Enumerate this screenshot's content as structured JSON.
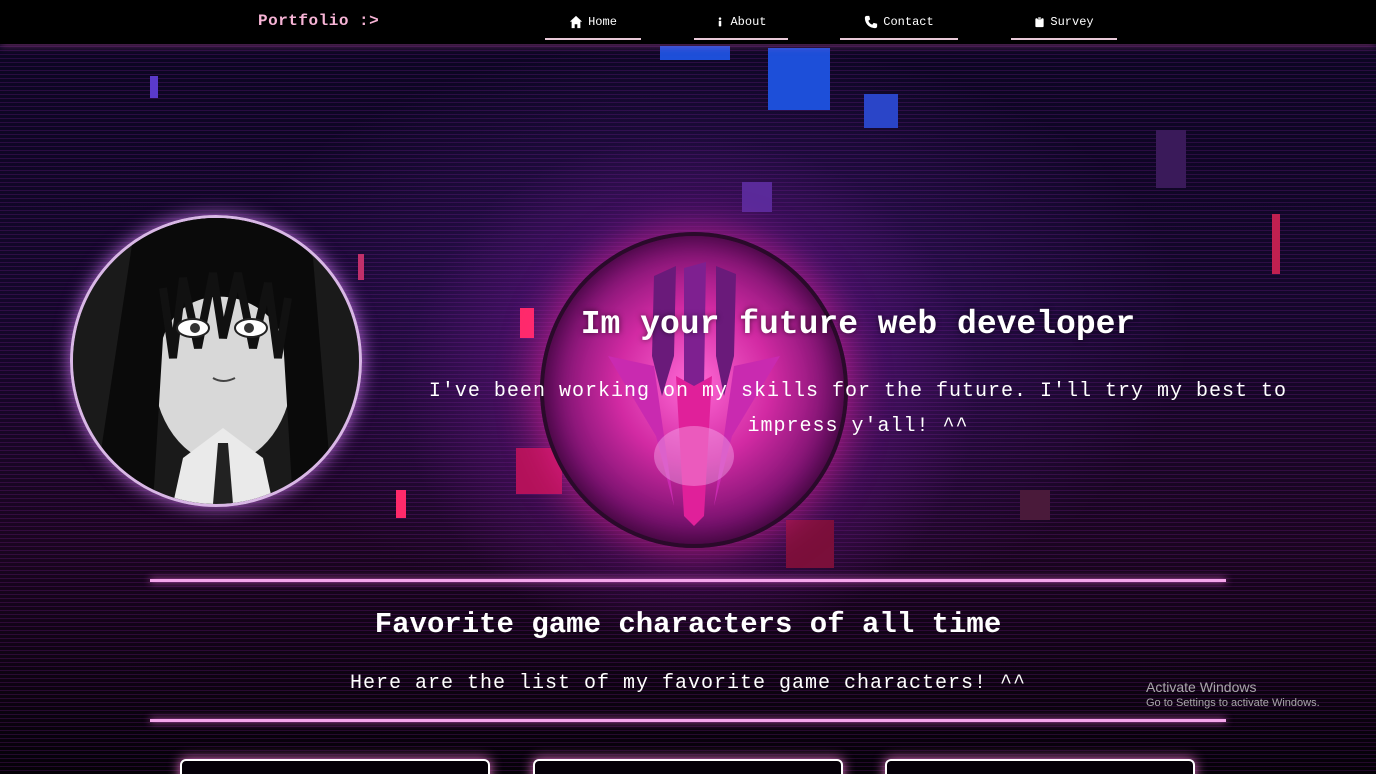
{
  "nav": {
    "brand": "Portfolio :>",
    "items": [
      {
        "label": "Home",
        "icon": "home-icon"
      },
      {
        "label": "About",
        "icon": "info-icon"
      },
      {
        "label": "Contact",
        "icon": "phone-icon"
      },
      {
        "label": "Survey",
        "icon": "clipboard-icon"
      }
    ]
  },
  "hero": {
    "title": "Im your future web developer",
    "subtitle": "I've been working on my skills for the future. I'll try my best to impress y'all! ^^"
  },
  "section": {
    "title": "Favorite game characters of all time",
    "subtitle": "Here are the list of my favorite game characters! ^^"
  },
  "watermark": {
    "line1": "Activate Windows",
    "line2": "Go to Settings to activate Windows."
  },
  "colors": {
    "accent": "#f4a6ea",
    "brand": "#f6b3d5",
    "background": "#000000"
  }
}
